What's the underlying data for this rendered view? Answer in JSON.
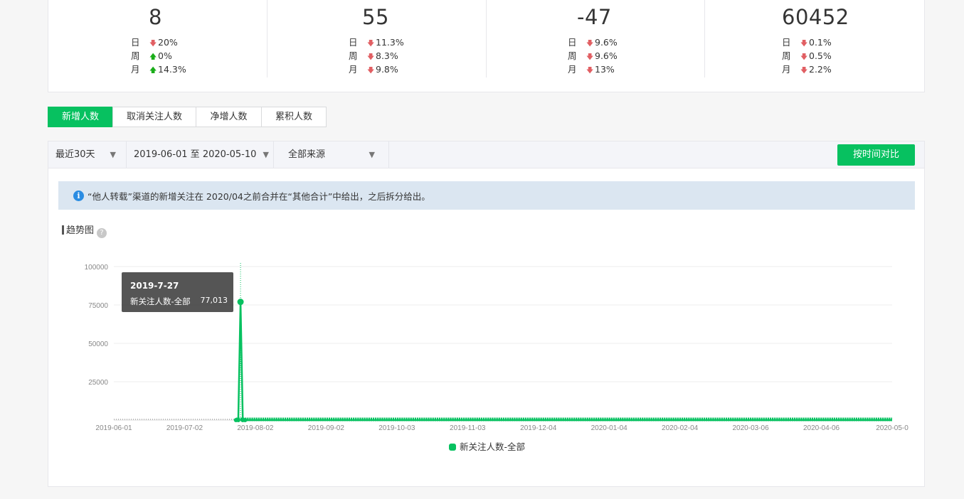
{
  "stats": [
    {
      "value": "8",
      "rows": [
        {
          "label": "日",
          "dir": "down",
          "pct": "20%"
        },
        {
          "label": "周",
          "dir": "up",
          "pct": "0%"
        },
        {
          "label": "月",
          "dir": "up",
          "pct": "14.3%"
        }
      ]
    },
    {
      "value": "55",
      "rows": [
        {
          "label": "日",
          "dir": "down",
          "pct": "11.3%"
        },
        {
          "label": "周",
          "dir": "down",
          "pct": "8.3%"
        },
        {
          "label": "月",
          "dir": "down",
          "pct": "9.8%"
        }
      ]
    },
    {
      "value": "-47",
      "rows": [
        {
          "label": "日",
          "dir": "down",
          "pct": "9.6%"
        },
        {
          "label": "周",
          "dir": "down",
          "pct": "9.6%"
        },
        {
          "label": "月",
          "dir": "down",
          "pct": "13%"
        }
      ]
    },
    {
      "value": "60452",
      "rows": [
        {
          "label": "日",
          "dir": "down",
          "pct": "0.1%"
        },
        {
          "label": "周",
          "dir": "down",
          "pct": "0.5%"
        },
        {
          "label": "月",
          "dir": "down",
          "pct": "2.2%"
        }
      ]
    }
  ],
  "colors": {
    "down": "#e15f63",
    "up": "#1aad19",
    "accent": "#07c160"
  },
  "tabs": [
    "新增人数",
    "取消关注人数",
    "净增人数",
    "累积人数"
  ],
  "active_tab": "新增人数",
  "filters": {
    "period": "最近30天",
    "date_range": "2019-06-01 至 2020-05-10",
    "source": "全部来源",
    "compare_button": "按时间对比"
  },
  "notice": "“他人转载”渠道的新增关注在 2020/04之前合并在“其他合计”中给出，之后拆分给出。",
  "trend_title": "趋势图",
  "tooltip": {
    "date": "2019-7-27",
    "series": "新关注人数-全部",
    "value": "77,013"
  },
  "chart_data": {
    "type": "line",
    "title": "",
    "xlabel": "",
    "ylabel": "",
    "ylim": [
      0,
      100000
    ],
    "yticks": [
      25000,
      50000,
      75000,
      100000
    ],
    "x_tick_labels": [
      "2019-06-01",
      "2019-07-02",
      "2019-08-02",
      "2019-09-02",
      "2019-10-03",
      "2019-11-03",
      "2019-12-04",
      "2020-01-04",
      "2020-02-04",
      "2020-03-06",
      "2020-04-06",
      "2020-05-0"
    ],
    "x_range": [
      "2019-06-01",
      "2020-05-10"
    ],
    "series": [
      {
        "name": "新关注人数-全部",
        "color": "#07c160",
        "points": [
          {
            "x": "2019-06-01",
            "y": 0
          },
          {
            "x": "2019-07-25",
            "y": 0
          },
          {
            "x": "2019-07-26",
            "y": 0
          },
          {
            "x": "2019-07-27",
            "y": 77013
          },
          {
            "x": "2019-07-28",
            "y": 0
          },
          {
            "x": "2019-07-29",
            "y": 0
          },
          {
            "x": "2020-05-10",
            "y": 0
          }
        ],
        "no_data_until": "2019-07-25"
      }
    ],
    "grid": true,
    "legend": "bottom"
  }
}
